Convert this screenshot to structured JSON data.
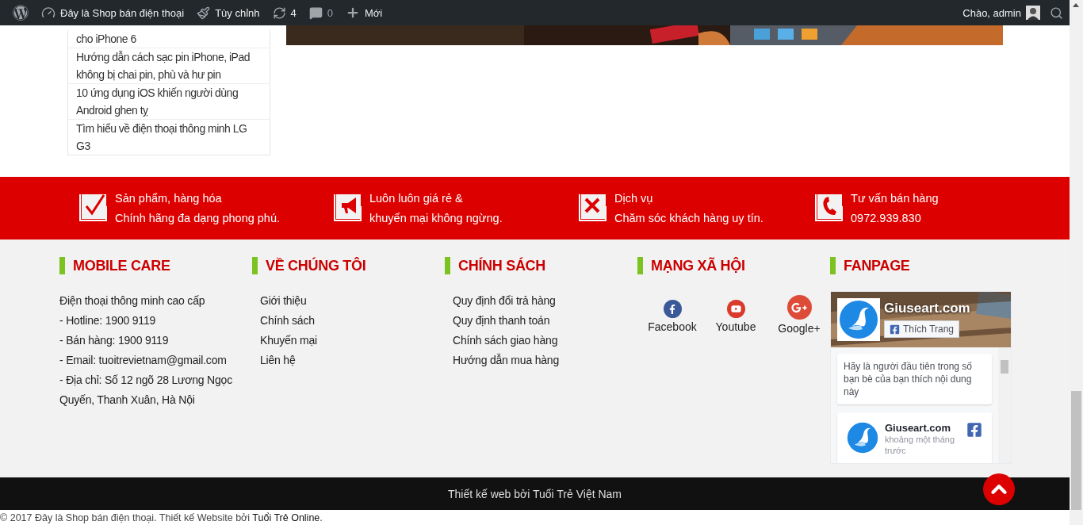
{
  "admin_bar": {
    "items": [
      {
        "kind": "logo"
      },
      {
        "kind": "site",
        "label": "Đây là Shop bán điện thoại"
      },
      {
        "kind": "customize",
        "label": "Tùy chỉnh"
      },
      {
        "kind": "updates",
        "label": "4"
      },
      {
        "kind": "comments",
        "label": "0"
      },
      {
        "kind": "new",
        "label": "Mới"
      }
    ],
    "greeting": "Chào, admin"
  },
  "sidebar_posts": [
    "cho iPhone 6",
    "Hướng dẫn cách sạc pin iPhone, iPad không bị chai pin, phù và hư pin",
    "10 ứng dụng iOS khiến người dùng Android ghen tỵ",
    "Tìm hiểu về điện thoại thông minh LG G3"
  ],
  "features": [
    {
      "kind": "check",
      "title": "Sản phẩm, hàng hóa",
      "subtitle": "Chính hãng đa dạng phong phú."
    },
    {
      "kind": "megaphone",
      "title": "Luôn luôn giá rẻ &",
      "subtitle": "khuyến mại không ngừng."
    },
    {
      "kind": "tools",
      "title": "Dịch vụ",
      "subtitle": "Chăm sóc khách hàng uy tín."
    },
    {
      "kind": "phone",
      "title": "Tư vấn bán hàng",
      "subtitle": "0972.939.830"
    }
  ],
  "footer_columns": [
    {
      "kind": "text",
      "title": "MOBILE CARE",
      "lines": [
        "Điện thoại thông minh cao cấp",
        "- Hotline: 1900 9119",
        "- Bán hàng: 1900 9119",
        "- Email: tuoitrevietnam@gmail.com",
        "- Địa chỉ: Số 12 ngõ 28 Lương Ngọc Quyến, Thanh Xuân, Hà Nội"
      ]
    },
    {
      "kind": "links",
      "title": "VỀ CHÚNG TÔI",
      "links": [
        "Giới thiệu",
        "Chính sách",
        "Khuyến mại",
        "Liên hệ"
      ]
    },
    {
      "kind": "links",
      "title": "CHÍNH SÁCH",
      "links": [
        "Quy định đổi trả hàng",
        "Quy định thanh toán",
        "Chính sách giao hàng",
        "Hướng dẫn mua hàng"
      ]
    },
    {
      "kind": "social",
      "title": "MẠNG XÃ HỘI",
      "networks": [
        {
          "kind": "facebook",
          "label": "Facebook"
        },
        {
          "kind": "youtube",
          "label": "Youtube"
        },
        {
          "kind": "google",
          "label": "Google+"
        }
      ]
    },
    {
      "kind": "fanpage",
      "title": "FANPAGE",
      "page_name": "Giuseart.com",
      "like_button": "Thích Trang",
      "prompt": "Hãy là người đầu tiên trong số bạn bè của bạn thích nội dung này",
      "post": {
        "name": "Giuseart.com",
        "time": "khoảng một tháng trước"
      }
    }
  ],
  "bottom_bar": {
    "credit": "Thiết kế web bởi Tuổi Trẻ Việt Nam"
  },
  "copyright": {
    "text": "© 2017 Đây là Shop bán điện thoại. Thiết kế Website bởi",
    "link": "Tuổi Trẻ Online",
    "end": "."
  }
}
